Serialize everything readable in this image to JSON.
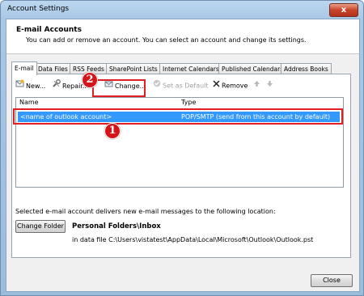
{
  "window": {
    "title": "Account Settings",
    "close_glyph": "x"
  },
  "header": {
    "title": "E-mail Accounts",
    "description": "You can add or remove an account. You can select an account and change its settings."
  },
  "tabs": [
    {
      "label": "E-mail",
      "active": true
    },
    {
      "label": "Data Files"
    },
    {
      "label": "RSS Feeds"
    },
    {
      "label": "SharePoint Lists"
    },
    {
      "label": "Internet Calendars"
    },
    {
      "label": "Published Calendars"
    },
    {
      "label": "Address Books"
    }
  ],
  "toolbar": {
    "new_label": "New...",
    "repair_label": "Repair...",
    "change_label": "Change...",
    "set_default_label": "Set as Default",
    "remove_label": "Remove"
  },
  "account_list": {
    "columns": [
      "Name",
      "Type"
    ],
    "rows": [
      {
        "name": "<name of outlook account>",
        "type": "POP/SMTP (send from this account by default)"
      }
    ]
  },
  "delivery": {
    "description": "Selected e-mail account delivers new e-mail messages to the following location:",
    "change_folder_label": "Change Folder",
    "folder_title": "Personal Folders\\Inbox",
    "folder_path": "in data file C:\\Users\\vistatest\\AppData\\Local\\Microsoft\\Outlook\\Outlook.pst"
  },
  "footer": {
    "close_label": "Close"
  },
  "annotations": {
    "badge_1": "1",
    "badge_2": "2"
  },
  "colors": {
    "highlight": "#e01e24",
    "selection": "#3399ff",
    "badge": "#d6151b"
  }
}
